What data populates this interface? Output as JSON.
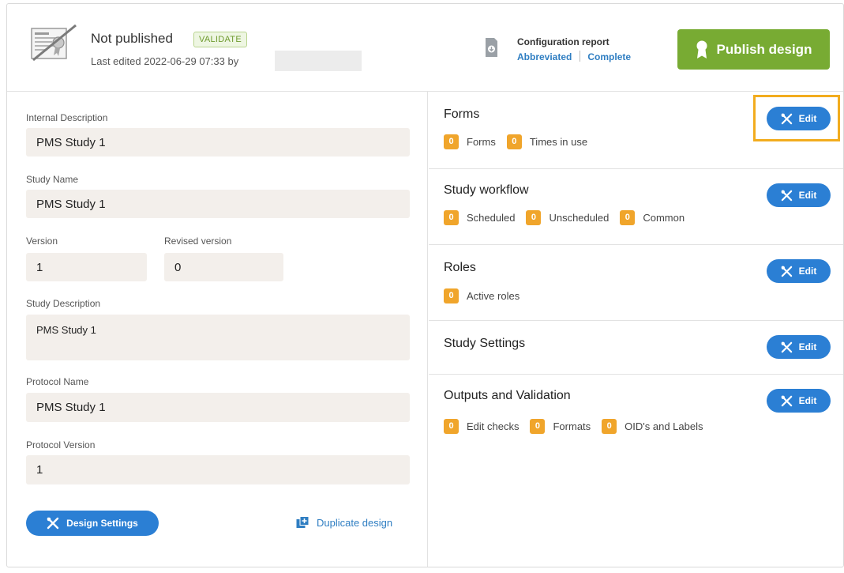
{
  "header": {
    "status": "Not published",
    "validate_label": "VALIDATE",
    "last_edited": "Last edited 2022-06-29 07:33 by",
    "report": {
      "title": "Configuration report",
      "abbreviated": "Abbreviated",
      "complete": "Complete"
    },
    "publish_label": "Publish design"
  },
  "left": {
    "internal_description": {
      "label": "Internal Description",
      "value": "PMS Study 1"
    },
    "study_name": {
      "label": "Study Name",
      "value": "PMS Study 1"
    },
    "version": {
      "label": "Version",
      "value": "1"
    },
    "revised_version": {
      "label": "Revised version",
      "value": "0"
    },
    "study_description": {
      "label": "Study Description",
      "value": "PMS Study 1"
    },
    "protocol_name": {
      "label": "Protocol Name",
      "value": "PMS Study 1"
    },
    "protocol_version": {
      "label": "Protocol Version",
      "value": "1"
    },
    "design_settings_label": "Design Settings",
    "duplicate_label": "Duplicate design"
  },
  "right": {
    "edit_label": "Edit",
    "sections": [
      {
        "title": "Forms",
        "counts": [
          {
            "value": "0",
            "label": "Forms"
          },
          {
            "value": "0",
            "label": "Times in use"
          }
        ]
      },
      {
        "title": "Study workflow",
        "counts": [
          {
            "value": "0",
            "label": "Scheduled"
          },
          {
            "value": "0",
            "label": "Unscheduled"
          },
          {
            "value": "0",
            "label": "Common"
          }
        ]
      },
      {
        "title": "Roles",
        "counts": [
          {
            "value": "0",
            "label": "Active roles"
          }
        ]
      },
      {
        "title": "Study Settings",
        "counts": []
      },
      {
        "title": "Outputs and Validation",
        "counts": [
          {
            "value": "0",
            "label": "Edit checks"
          },
          {
            "value": "0",
            "label": "Formats"
          },
          {
            "value": "0",
            "label": "OID's and Labels"
          }
        ]
      }
    ]
  },
  "colors": {
    "accent_blue": "#2b7fd4",
    "publish_green": "#78ab33",
    "badge_orange": "#f0a52b",
    "highlight_orange": "#f2ac1e"
  },
  "icons": {
    "certificate": "certificate-icon",
    "report": "report-download-icon",
    "publish": "award-ribbon-icon",
    "tools": "tools-icon",
    "duplicate": "duplicate-icon"
  }
}
